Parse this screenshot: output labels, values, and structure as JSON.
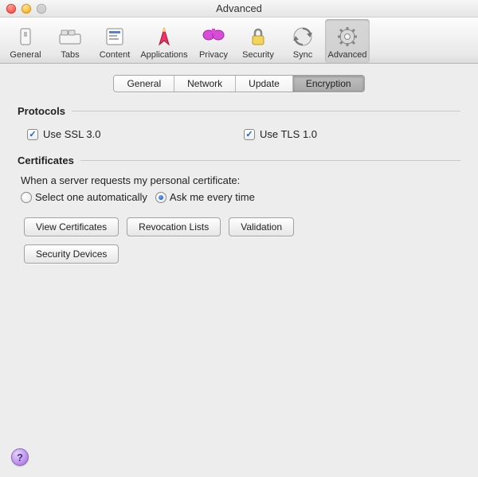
{
  "window": {
    "title": "Advanced"
  },
  "toolbar": {
    "items": [
      {
        "label": "General",
        "icon": "switch-icon"
      },
      {
        "label": "Tabs",
        "icon": "tabs-icon"
      },
      {
        "label": "Content",
        "icon": "content-icon"
      },
      {
        "label": "Applications",
        "icon": "applications-icon"
      },
      {
        "label": "Privacy",
        "icon": "privacy-icon"
      },
      {
        "label": "Security",
        "icon": "lock-icon"
      },
      {
        "label": "Sync",
        "icon": "sync-icon"
      },
      {
        "label": "Advanced",
        "icon": "gear-icon"
      }
    ],
    "selected": "Advanced"
  },
  "subtabs": {
    "items": [
      "General",
      "Network",
      "Update",
      "Encryption"
    ],
    "active": "Encryption"
  },
  "protocols": {
    "header": "Protocols",
    "ssl": {
      "label": "Use SSL 3.0",
      "checked": true
    },
    "tls": {
      "label": "Use TLS 1.0",
      "checked": true
    }
  },
  "certificates": {
    "header": "Certificates",
    "prompt": "When a server requests my personal certificate:",
    "radio_auto": "Select one automatically",
    "radio_ask": "Ask me every time",
    "selected_radio": "ask",
    "buttons": {
      "view": "View Certificates",
      "revocation": "Revocation Lists",
      "validation": "Validation",
      "devices": "Security Devices"
    }
  },
  "help": {
    "glyph": "?"
  }
}
